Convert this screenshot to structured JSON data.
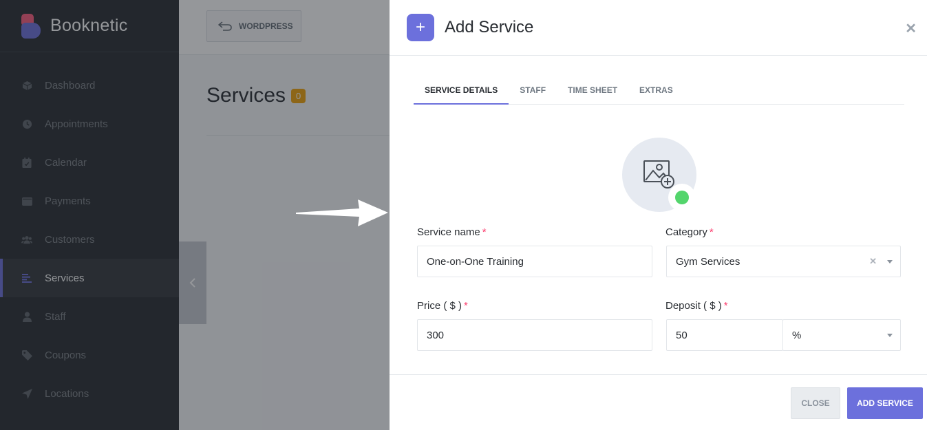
{
  "sidebar": {
    "brand": "Booknetic",
    "items": [
      {
        "label": "Dashboard",
        "icon": "cube-icon"
      },
      {
        "label": "Appointments",
        "icon": "clock-icon"
      },
      {
        "label": "Calendar",
        "icon": "calendar-icon"
      },
      {
        "label": "Payments",
        "icon": "wallet-icon"
      },
      {
        "label": "Customers",
        "icon": "users-icon"
      },
      {
        "label": "Services",
        "icon": "list-icon",
        "active": true
      },
      {
        "label": "Staff",
        "icon": "user-icon"
      },
      {
        "label": "Coupons",
        "icon": "tag-icon"
      },
      {
        "label": "Locations",
        "icon": "location-arrow-icon"
      }
    ]
  },
  "topbar": {
    "wordpress_label": "WORDPRESS"
  },
  "page": {
    "title": "Services",
    "count": "0"
  },
  "panel": {
    "title": "Add Service",
    "tabs": [
      "SERVICE DETAILS",
      "STAFF",
      "TIME SHEET",
      "EXTRAS"
    ],
    "active_tab": "SERVICE DETAILS",
    "fields": {
      "service_name": {
        "label": "Service name",
        "value": "One-on-One Training"
      },
      "category": {
        "label": "Category",
        "value": "Gym Services"
      },
      "price": {
        "label": "Price ( $ )",
        "value": "300"
      },
      "deposit": {
        "label": "Deposit ( $ )",
        "value": "50",
        "type": "%"
      }
    },
    "required_mark": "*",
    "close_label": "CLOSE",
    "add_label": "ADD SERVICE"
  },
  "colors": {
    "accent": "#6c70dc",
    "sidebar_bg": "#292d32",
    "status_dot": "#53d56c",
    "badge": "#f0a30a",
    "required": "#fb3e6e"
  }
}
